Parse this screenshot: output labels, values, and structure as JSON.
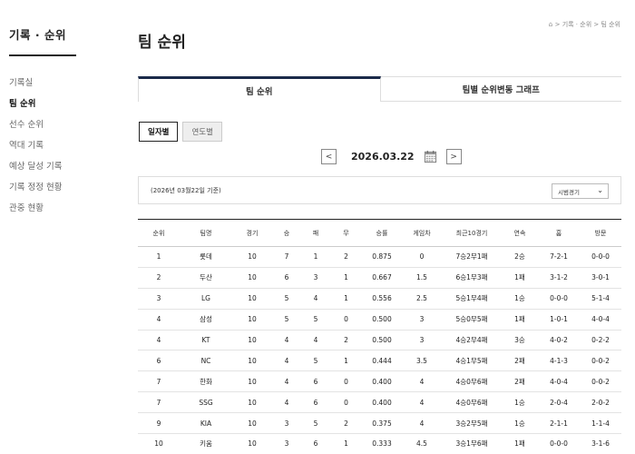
{
  "sidebar": {
    "title": "기록 · 순위",
    "items": [
      {
        "label": "기록실",
        "active": false
      },
      {
        "label": "팀 순위",
        "active": true
      },
      {
        "label": "선수 순위",
        "active": false
      },
      {
        "label": "역대 기록",
        "active": false
      },
      {
        "label": "예상 달성 기록",
        "active": false
      },
      {
        "label": "기록 정정 현황",
        "active": false
      },
      {
        "label": "관중 현황",
        "active": false
      }
    ]
  },
  "header": {
    "title": "팀 순위",
    "breadcrumb": "> 기록 · 순위 > 팀 순위"
  },
  "tabs": [
    {
      "label": "팀 순위",
      "active": true
    },
    {
      "label": "팀별 순위변동 그래프",
      "active": false
    }
  ],
  "subtabs": [
    {
      "label": "일자별",
      "active": true
    },
    {
      "label": "연도별",
      "active": false
    }
  ],
  "date": {
    "value": "2026.03.22",
    "prev": "<",
    "next": ">"
  },
  "filter": {
    "caption": "(2026년 03월22일 기준)",
    "select_value": "시범경기"
  },
  "table": {
    "headers": [
      "순위",
      "팀명",
      "경기",
      "승",
      "패",
      "무",
      "승률",
      "게임차",
      "최근10경기",
      "연속",
      "홈",
      "방문"
    ],
    "rows": [
      [
        "1",
        "롯데",
        "10",
        "7",
        "1",
        "2",
        "0.875",
        "0",
        "7승2무1패",
        "2승",
        "7-2-1",
        "0-0-0"
      ],
      [
        "2",
        "두산",
        "10",
        "6",
        "3",
        "1",
        "0.667",
        "1.5",
        "6승1무3패",
        "1패",
        "3-1-2",
        "3-0-1"
      ],
      [
        "3",
        "LG",
        "10",
        "5",
        "4",
        "1",
        "0.556",
        "2.5",
        "5승1무4패",
        "1승",
        "0-0-0",
        "5-1-4"
      ],
      [
        "4",
        "삼성",
        "10",
        "5",
        "5",
        "0",
        "0.500",
        "3",
        "5승0무5패",
        "1패",
        "1-0-1",
        "4-0-4"
      ],
      [
        "4",
        "KT",
        "10",
        "4",
        "4",
        "2",
        "0.500",
        "3",
        "4승2무4패",
        "3승",
        "4-0-2",
        "0-2-2"
      ],
      [
        "6",
        "NC",
        "10",
        "4",
        "5",
        "1",
        "0.444",
        "3.5",
        "4승1무5패",
        "2패",
        "4-1-3",
        "0-0-2"
      ],
      [
        "7",
        "한화",
        "10",
        "4",
        "6",
        "0",
        "0.400",
        "4",
        "4승0무6패",
        "2패",
        "4-0-4",
        "0-0-2"
      ],
      [
        "7",
        "SSG",
        "10",
        "4",
        "6",
        "0",
        "0.400",
        "4",
        "4승0무6패",
        "1승",
        "2-0-4",
        "2-0-2"
      ],
      [
        "9",
        "KIA",
        "10",
        "3",
        "5",
        "2",
        "0.375",
        "4",
        "3승2무5패",
        "1승",
        "2-1-1",
        "1-1-4"
      ],
      [
        "10",
        "키움",
        "10",
        "3",
        "6",
        "1",
        "0.333",
        "4.5",
        "3승1무6패",
        "1패",
        "0-0-0",
        "3-1-6"
      ]
    ]
  },
  "colors": {
    "accent": "#1b2a4a",
    "border": "#dddddd"
  }
}
